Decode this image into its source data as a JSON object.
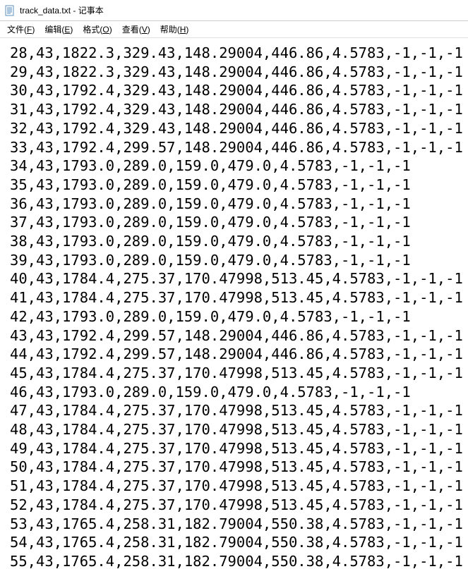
{
  "window": {
    "filename": "track_data.txt",
    "app_name": "记事本"
  },
  "menu": {
    "file": {
      "label": "文件",
      "accel": "F"
    },
    "edit": {
      "label": "编辑",
      "accel": "E"
    },
    "format": {
      "label": "格式",
      "accel": "O"
    },
    "view": {
      "label": "查看",
      "accel": "V"
    },
    "help": {
      "label": "帮助",
      "accel": "H"
    }
  },
  "lines": [
    "28,43,1822.3,329.43,148.29004,446.86,4.5783,-1,-1,-1",
    "29,43,1822.3,329.43,148.29004,446.86,4.5783,-1,-1,-1",
    "30,43,1792.4,329.43,148.29004,446.86,4.5783,-1,-1,-1",
    "31,43,1792.4,329.43,148.29004,446.86,4.5783,-1,-1,-1",
    "32,43,1792.4,329.43,148.29004,446.86,4.5783,-1,-1,-1",
    "33,43,1792.4,299.57,148.29004,446.86,4.5783,-1,-1,-1",
    "34,43,1793.0,289.0,159.0,479.0,4.5783,-1,-1,-1",
    "35,43,1793.0,289.0,159.0,479.0,4.5783,-1,-1,-1",
    "36,43,1793.0,289.0,159.0,479.0,4.5783,-1,-1,-1",
    "37,43,1793.0,289.0,159.0,479.0,4.5783,-1,-1,-1",
    "38,43,1793.0,289.0,159.0,479.0,4.5783,-1,-1,-1",
    "39,43,1793.0,289.0,159.0,479.0,4.5783,-1,-1,-1",
    "40,43,1784.4,275.37,170.47998,513.45,4.5783,-1,-1,-1",
    "41,43,1784.4,275.37,170.47998,513.45,4.5783,-1,-1,-1",
    "42,43,1793.0,289.0,159.0,479.0,4.5783,-1,-1,-1",
    "43,43,1792.4,299.57,148.29004,446.86,4.5783,-1,-1,-1",
    "44,43,1792.4,299.57,148.29004,446.86,4.5783,-1,-1,-1",
    "45,43,1784.4,275.37,170.47998,513.45,4.5783,-1,-1,-1",
    "46,43,1793.0,289.0,159.0,479.0,4.5783,-1,-1,-1",
    "47,43,1784.4,275.37,170.47998,513.45,4.5783,-1,-1,-1",
    "48,43,1784.4,275.37,170.47998,513.45,4.5783,-1,-1,-1",
    "49,43,1784.4,275.37,170.47998,513.45,4.5783,-1,-1,-1",
    "50,43,1784.4,275.37,170.47998,513.45,4.5783,-1,-1,-1",
    "51,43,1784.4,275.37,170.47998,513.45,4.5783,-1,-1,-1",
    "52,43,1784.4,275.37,170.47998,513.45,4.5783,-1,-1,-1",
    "53,43,1765.4,258.31,182.79004,550.38,4.5783,-1,-1,-1",
    "54,43,1765.4,258.31,182.79004,550.38,4.5783,-1,-1,-1",
    "55,43,1765.4,258.31,182.79004,550.38,4.5783,-1,-1,-1"
  ]
}
